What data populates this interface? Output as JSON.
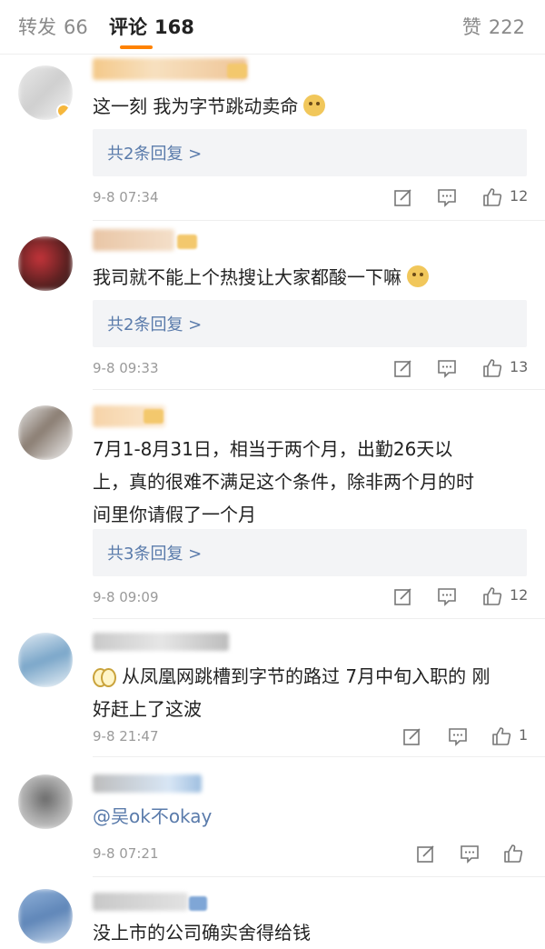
{
  "tabs": {
    "repost_label": "转发",
    "repost_count": "66",
    "comments_label": "评论",
    "comments_count": "168",
    "likes_label": "赞",
    "likes_count": "222"
  },
  "colors": {
    "accent": "#ff8200",
    "link": "#5a7bab",
    "reply_bg": "#f3f4f6",
    "muted": "#9a9a9a"
  },
  "icons": [
    "edit-icon",
    "comment-icon",
    "thumbs-up-icon",
    "emoji-doge",
    "emoji-glasses"
  ],
  "comments": [
    {
      "text": "这一刻 我为字节跳动卖命",
      "replies": "共2条回复 >",
      "time": "9-8 07:34",
      "likes": "12"
    },
    {
      "text": "我司就不能上个热搜让大家都酸一下嘛",
      "replies": "共2条回复 >",
      "time": "9-8 09:33",
      "likes": "13"
    },
    {
      "text_line1": "7月1-8月31日，相当于两个月，出勤26天以",
      "text_line2": "上，真的很难不满足这个条件，除非两个月的时",
      "text_line3": "间里你请假了一个月",
      "replies": "共3条回复 >",
      "time": "9-8 09:09",
      "likes": "12"
    },
    {
      "text_line1": "从凤凰网跳槽到字节的路过 7月中旬入职的 刚",
      "text_line2": "好赶上了这波",
      "time": "9-8 21:47",
      "likes": "1"
    },
    {
      "mention": "@吴ok不okay",
      "time": "9-8 07:21"
    },
    {
      "text": "没上市的公司确实舍得给钱"
    }
  ]
}
